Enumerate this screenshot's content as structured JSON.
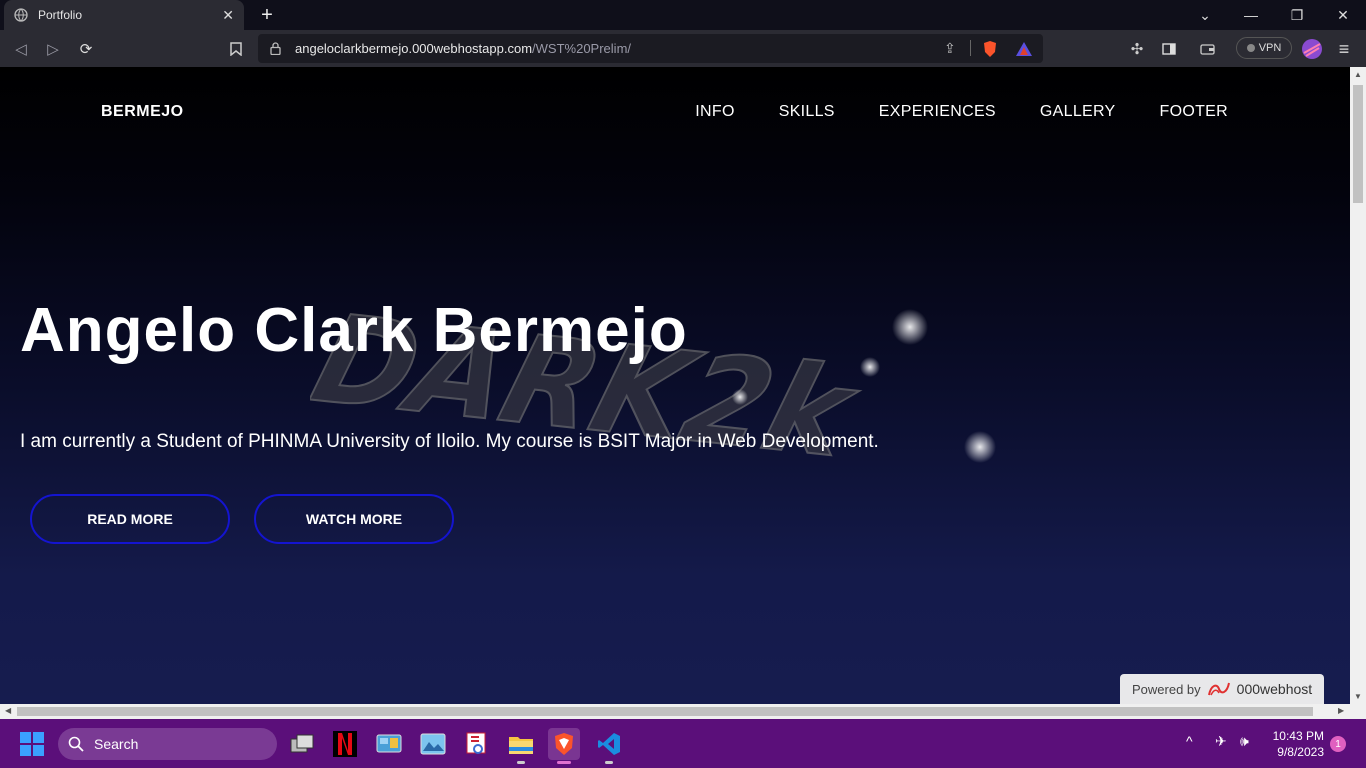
{
  "browser": {
    "tab_title": "Portfolio",
    "tab_close": "✕",
    "new_tab": "+",
    "url_host": "angeloclarkbermejo.000webhostapp.com",
    "url_path": "/WST%20Prelim/",
    "vpn_label": "VPN",
    "window_controls": {
      "minimize": "—",
      "restore": "❐",
      "close": "✕",
      "tabs_dropdown": "⌄"
    }
  },
  "page": {
    "logo": "BERMEJO",
    "nav": [
      "INFO",
      "SKILLS",
      "EXPERIENCES",
      "GALLERY",
      "FOOTER"
    ],
    "hero_title": "Angelo Clark Bermejo",
    "hero_text": "I am currently a Student of PHINMA University of Iloilo. My course is BSIT Major in Web Development.",
    "buttons": {
      "read_more": "READ MORE",
      "watch_more": "WATCH MORE"
    },
    "watermark_text": "DARK2k",
    "powered_by": "Powered by",
    "powered_brand": "000webhost",
    "colors": {
      "button_border": "#1414d0",
      "background_bottom": "#161c4f"
    }
  },
  "taskbar": {
    "search_placeholder": "Search",
    "time": "10:43 PM",
    "date": "9/8/2023",
    "notification_count": "1",
    "apps": [
      "task-view",
      "netflix",
      "control-panel",
      "photos",
      "snipping-tool",
      "file-explorer",
      "brave-browser",
      "vscode"
    ]
  }
}
